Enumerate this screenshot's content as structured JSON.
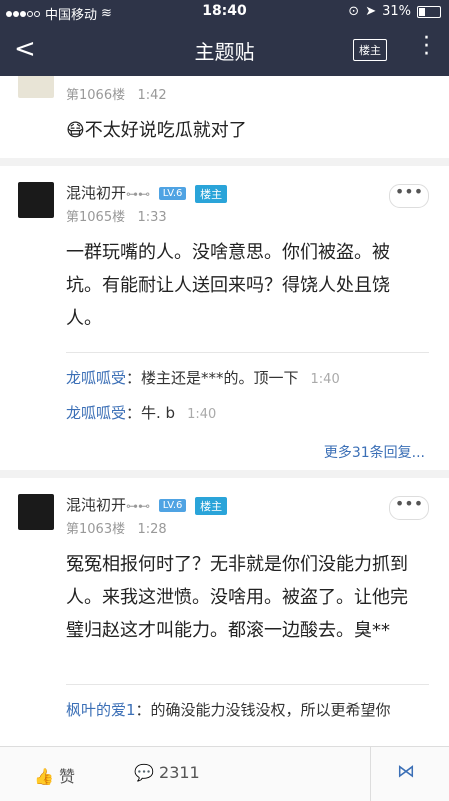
{
  "status": {
    "carrier": "中国移动",
    "time": "18:40",
    "battery": "31%",
    "battery_fraction": 0.31
  },
  "nav": {
    "title": "主题贴",
    "lz_label": "楼主"
  },
  "posts": [
    {
      "floor": "第1066楼",
      "time": "1:42",
      "text": "不太好说吃瓜就对了"
    },
    {
      "name": "混沌初开",
      "level": "LV.6",
      "lz": "楼主",
      "floor": "第1065楼",
      "time": "1:33",
      "text": "一群玩嘴的人。没啥意思。你们被盗。被坑。有能耐让人送回来吗？得饶人处且饶人。",
      "replies": [
        {
          "name": "龙呱呱受",
          "text": "：楼主还是***的。顶一下",
          "time": "1:40"
        },
        {
          "name": "龙呱呱受",
          "text": "：牛. b",
          "time": "1:40"
        }
      ],
      "more": "更多31条回复..."
    },
    {
      "name": "混沌初开",
      "level": "LV.6",
      "lz": "楼主",
      "floor": "第1063楼",
      "time": "1:28",
      "text": "冤冤相报何时了？无非就是你们没能力抓到人。来我这泄愤。没啥用。被盗了。让他完璧归赵这才叫能力。都滚一边酸去。臭**",
      "replies": [
        {
          "name": "枫叶的爱1",
          "text": "：的确没能力没钱没权，所以更希望你"
        }
      ]
    }
  ],
  "bottom": {
    "like": "赞",
    "comment_count": "2311"
  }
}
